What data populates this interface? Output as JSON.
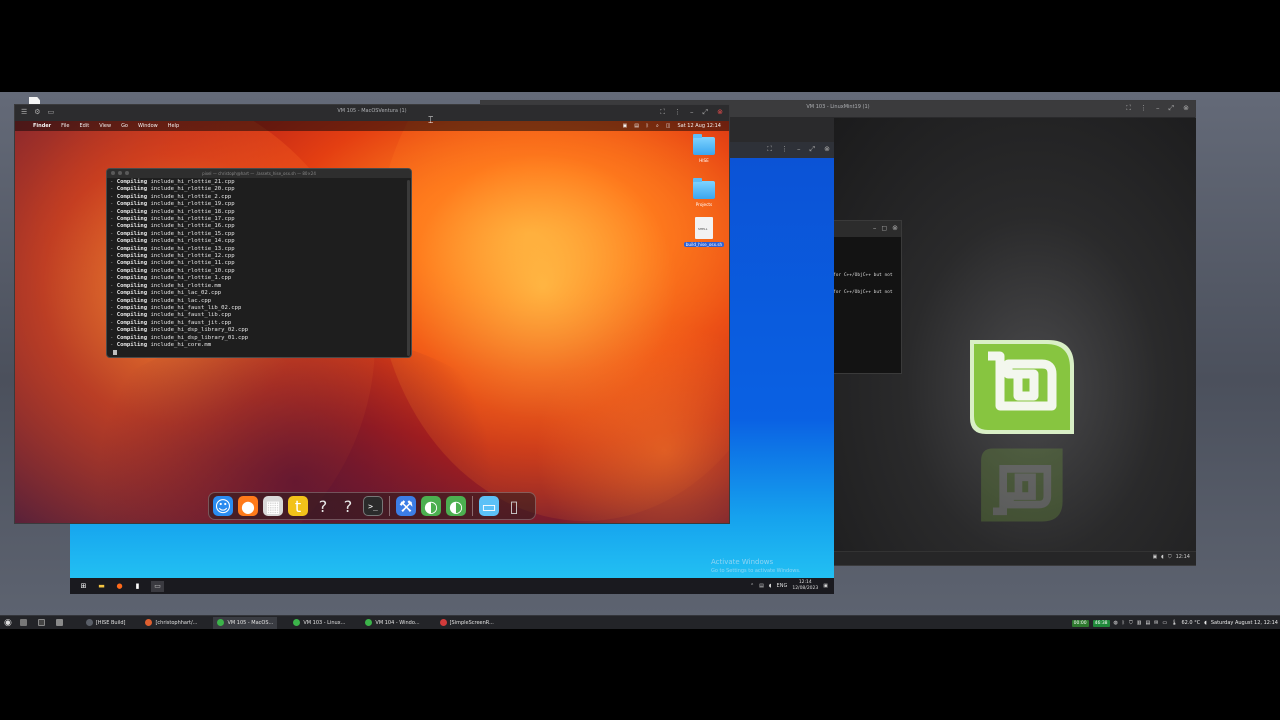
{
  "host": {
    "taskbar": {
      "windows": [
        {
          "label": "[HISE Build]",
          "color": "#5a5f68"
        },
        {
          "label": "[christophhart/...",
          "color": "#e06030"
        },
        {
          "label": "VM 105 - MacOS...",
          "color": "#3cb44a",
          "active": true
        },
        {
          "label": "VM 103 - Linux...",
          "color": "#3cb44a"
        },
        {
          "label": "VM 104 - Windo...",
          "color": "#3cb44a"
        },
        {
          "label": "[SimpleScreenR...",
          "color": "#d23b3b"
        }
      ],
      "meter_1": "00:00",
      "meter_2": "46:38",
      "temperature": "62.0 °C",
      "datetime": "Saturday August 12, 12:14"
    }
  },
  "vm_mac": {
    "title": "VM 105 - MacOSVentura (1)",
    "menubar": {
      "apple_icon": "apple-icon",
      "items": [
        "Finder",
        "File",
        "Edit",
        "View",
        "Go",
        "Window",
        "Help"
      ],
      "clock": "Sat 12 Aug  12:14"
    },
    "terminal": {
      "title": "pixel — christoph@hart — ./assets_hise_osx.sh — 80×24",
      "prefix": "Compiling",
      "lines": [
        "include_hi_rlottie_21.cpp",
        "include_hi_rlottie_20.cpp",
        "include_hi_rlottie_2.cpp",
        "include_hi_rlottie_19.cpp",
        "include_hi_rlottie_18.cpp",
        "include_hi_rlottie_17.cpp",
        "include_hi_rlottie_16.cpp",
        "include_hi_rlottie_15.cpp",
        "include_hi_rlottie_14.cpp",
        "include_hi_rlottie_13.cpp",
        "include_hi_rlottie_12.cpp",
        "include_hi_rlottie_11.cpp",
        "include_hi_rlottie_10.cpp",
        "include_hi_rlottie_1.cpp",
        "include_hi_rlottie.mm",
        "include_hi_lac_02.cpp",
        "include_hi_lac.cpp",
        "include_hi_faust_lib_02.cpp",
        "include_hi_faust_lib.cpp",
        "include_hi_faust_jit.cpp",
        "include_hi_dsp_library_02.cpp",
        "include_hi_dsp_library_01.cpp",
        "include_hi_core.mm"
      ]
    },
    "desktop_icons": [
      {
        "label": "HISE",
        "type": "folder"
      },
      {
        "label": "Projects",
        "type": "folder"
      },
      {
        "label": "build_hise_osx.sh",
        "type": "script",
        "selected": true
      }
    ],
    "dock": [
      {
        "name": "finder-icon",
        "glyph": "☺",
        "bg": "#2a8cf0"
      },
      {
        "name": "firefox-icon",
        "glyph": "●",
        "bg": "#ff7a1a"
      },
      {
        "name": "launchpad-icon",
        "glyph": "▦",
        "bg": "#d9d9d9"
      },
      {
        "name": "t-app-icon",
        "glyph": "t",
        "bg": "#f2c21a"
      },
      {
        "name": "unknown-app-icon",
        "glyph": "?",
        "bg": "transparent"
      },
      {
        "name": "unknown-app-icon",
        "glyph": "?",
        "bg": "transparent"
      },
      {
        "name": "terminal-icon",
        "glyph": ">_",
        "bg": "#2b2b2b"
      },
      {
        "name": "separator",
        "glyph": "",
        "bg": ""
      },
      {
        "name": "xcode-icon",
        "glyph": "⚒",
        "bg": "#3c7ee6"
      },
      {
        "name": "reaper-icon",
        "glyph": "◐",
        "bg": "#4caf50"
      },
      {
        "name": "reaper-icon-2",
        "glyph": "◐",
        "bg": "#4caf50"
      },
      {
        "name": "separator",
        "glyph": "",
        "bg": ""
      },
      {
        "name": "downloads-folder-icon",
        "glyph": "▭",
        "bg": "#5cc1f7"
      },
      {
        "name": "trash-icon",
        "glyph": "▯",
        "bg": "transparent"
      }
    ]
  },
  "vm_mint": {
    "title": "VM 103 - LinuxMint19 (1)",
    "terminal_lines": [
      "for C++/ObjC++ but not",
      "for C++/ObjC++ but not"
    ],
    "panel_clock": "12:14"
  },
  "vm_win": {
    "activate_title": "Activate Windows",
    "activate_subtitle": "Go to Settings to activate Windows.",
    "tray_lang": "ENG",
    "clock_time": "12:14",
    "clock_date": "12/08/2023"
  }
}
